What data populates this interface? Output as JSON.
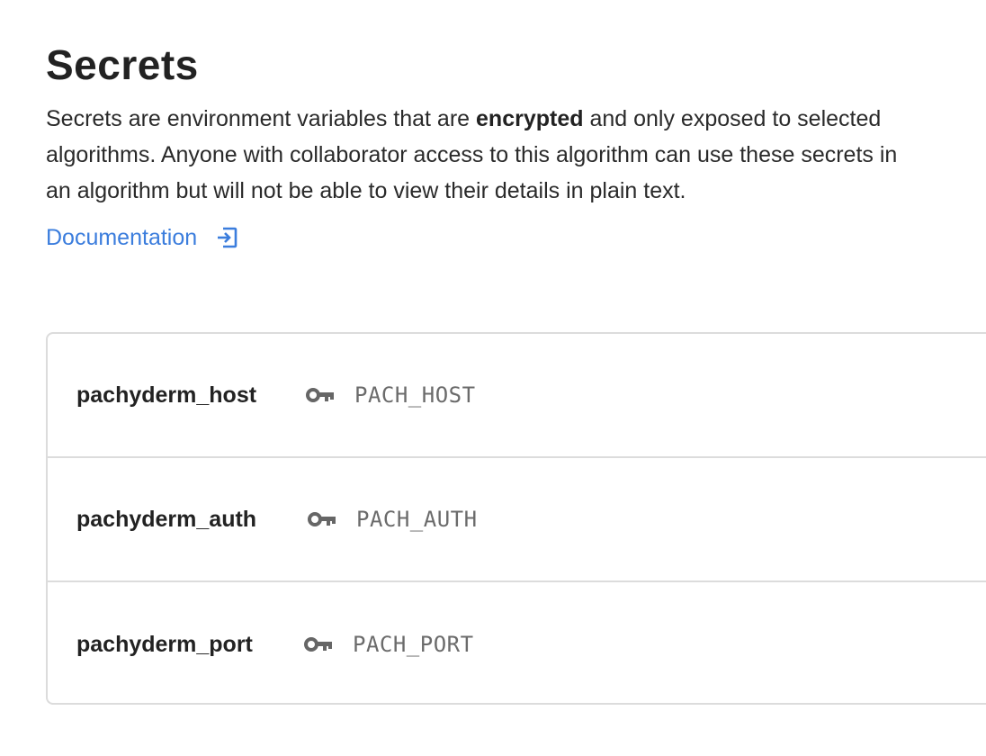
{
  "header": {
    "title": "Secrets"
  },
  "description": {
    "before": "Secrets are environment variables that are ",
    "emphasis": "encrypted",
    "after": " and only exposed to selected algorithms. Anyone with collaborator access to this algorithm can use these secrets in an algorithm but will not be able to view their details in plain text."
  },
  "documentation": {
    "label": "Documentation",
    "icon": "external-link-icon"
  },
  "secrets": [
    {
      "name": "pachyderm_host",
      "icon": "key-icon",
      "variable": "PACH_HOST"
    },
    {
      "name": "pachyderm_auth",
      "icon": "key-icon",
      "variable": "PACH_AUTH"
    },
    {
      "name": "pachyderm_port",
      "icon": "key-icon",
      "variable": "PACH_PORT"
    }
  ],
  "colors": {
    "link": "#3b7ddd",
    "text": "#222222",
    "muted": "#6b6b6b",
    "border": "#dcdcdc"
  }
}
